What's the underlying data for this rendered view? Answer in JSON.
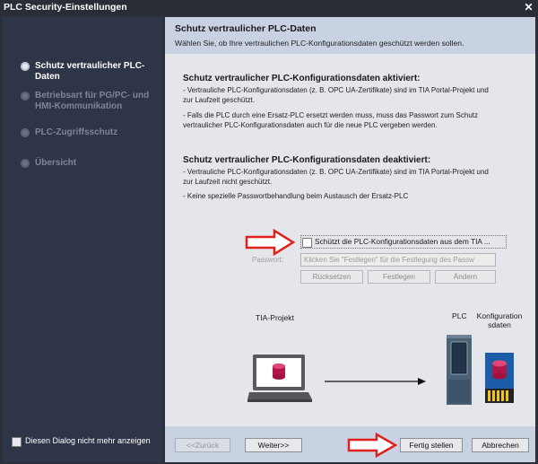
{
  "window": {
    "title": "PLC Security-Einstellungen",
    "close_glyph": "✕"
  },
  "sidebar": {
    "steps": [
      {
        "label": "Schutz vertraulicher PLC-Daten",
        "state": "active"
      },
      {
        "label": "Betriebsart für PG/PC- und HMI-Kommunikation",
        "state": "inactive"
      },
      {
        "label": "PLC-Zugriffsschutz",
        "state": "inactive"
      },
      {
        "label": "Übersicht",
        "state": "inactive"
      }
    ],
    "dont_show_label": "Diesen Dialog nicht mehr anzeigen"
  },
  "header": {
    "title": "Schutz vertraulicher PLC-Daten",
    "subtitle": "Wählen Sie, ob Ihre vertraulichen PLC-Konfigurationsdaten geschützt werden sollen."
  },
  "content": {
    "activated_title": "Schutz vertraulicher PLC-Konfigurationsdaten aktiviert:",
    "activated_lines": [
      "- Vertrauliche PLC-Konfigurationsdaten (z. B. OPC UA-Zertifikate) sind im TIA Portal-Projekt und",
      "zur Laufzeit geschützt.",
      "- Falls die PLC durch eine Ersatz-PLC ersetzt werden muss, muss das Passwort zum Schutz",
      "vertraulicher PLC-Konfigurationsdaten auch für die neue PLC vergeben werden."
    ],
    "deactivated_title": "Schutz vertraulicher PLC-Konfigurationsdaten deaktiviert:",
    "deactivated_lines": [
      "- Vertrauliche PLC-Konfigurationsdaten (z. B. OPC UA-Zertifikate) sind im TIA Portal-Projekt und",
      "zur Laufzeit nicht geschützt.",
      "- Keine spezielle Passwortbehandlung beim Austausch der Ersatz-PLC"
    ],
    "protect_checkbox_label": "Schützt die PLC-Konfigurationsdaten aus dem TIA ...",
    "password_label": "Passwort:",
    "password_placeholder": "Klicken Sie \"Festlegen\" für die Festlegung des Passw",
    "reset_button": "Rücksetzen",
    "set_button": "Festlegen",
    "change_button": "Ändern",
    "diagram": {
      "tia_project_label": "TIA-Projekt",
      "plc_label": "PLC",
      "config_data_label": "Konfiguration sdaten"
    }
  },
  "footer": {
    "back_button": "<<Zurück",
    "next_button": "Weiter>>",
    "finish_button": "Fertig stellen",
    "cancel_button": "Abbrechen"
  },
  "colors": {
    "annotation_arrow": "#e0211b",
    "sidebar_bg": "#2f3548",
    "header_bg": "#c9d2e2",
    "content_bg": "#e4e6ec"
  }
}
